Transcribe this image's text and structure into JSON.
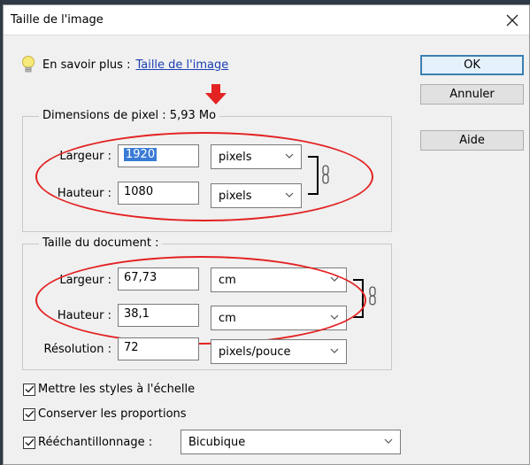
{
  "dialog": {
    "title": "Taille de l'image",
    "info_label": "En savoir plus :",
    "info_link": "Taille de l'image"
  },
  "buttons": {
    "ok": "OK",
    "cancel": "Annuler",
    "help": "Aide"
  },
  "pixel_dimensions": {
    "legend": "Dimensions de pixel : 5,93 Mo",
    "width_label": "Largeur :",
    "width_value": "1920",
    "width_unit": "pixels",
    "height_label": "Hauteur :",
    "height_value": "1080",
    "height_unit": "pixels"
  },
  "document_size": {
    "legend": "Taille du document :",
    "width_label": "Largeur :",
    "width_value": "67,73",
    "width_unit": "cm",
    "height_label": "Hauteur :",
    "height_value": "38,1",
    "height_unit": "cm",
    "resolution_label": "Résolution :",
    "resolution_value": "72",
    "resolution_unit": "pixels/pouce"
  },
  "options": {
    "scale_styles": "Mettre les styles à l'échelle",
    "constrain_proportions": "Conserver les proportions",
    "resample_label": "Rééchantillonnage :",
    "resample_value": "Bicubique"
  },
  "icons": {
    "info": "lightbulb-icon",
    "close": "close-icon",
    "link": "chain-link-icon",
    "dropdown": "chevron-down-icon",
    "annotation_arrow": "red-arrow-down-icon"
  },
  "colors": {
    "annotation": "#e32222",
    "link": "#1a3fb3",
    "selection": "#3a7bd5"
  }
}
